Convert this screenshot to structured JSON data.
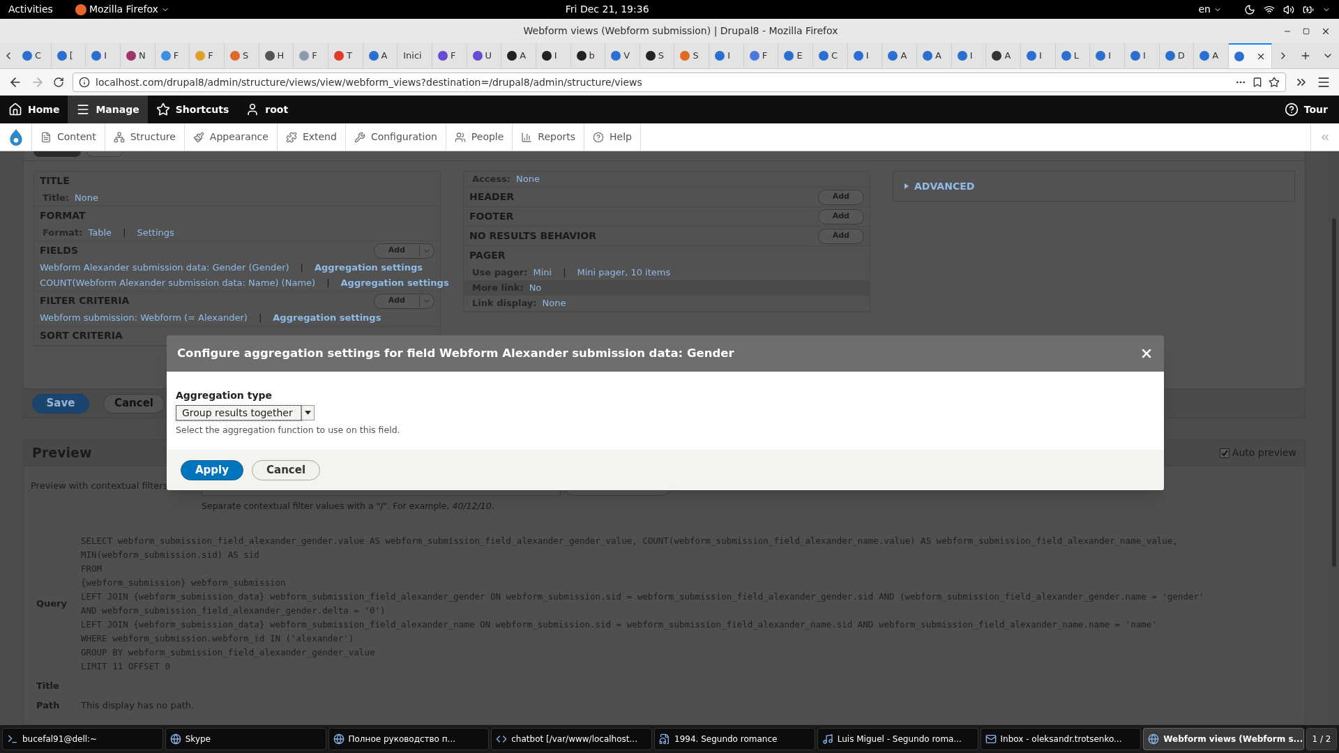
{
  "system_bar": {
    "activities": "Activities",
    "app_menu": "Mozilla Firefox",
    "clock": "Fri Dec 21, 19:36",
    "language": "en"
  },
  "window": {
    "title": "Webform views (Webform submission) | Drupal8 - Mozilla Firefox"
  },
  "browser_tabs": [
    {
      "label": "C",
      "color": "#2a6fd1",
      "selected": false
    },
    {
      "label": "[",
      "color": "#2a6fd1",
      "selected": false
    },
    {
      "label": "I",
      "color": "#2a6fd1",
      "selected": false
    },
    {
      "label": "N",
      "color": "#a0356b",
      "selected": false
    },
    {
      "label": "F",
      "color": "#3b8fe0",
      "selected": false
    },
    {
      "label": "F",
      "color": "#e0a030",
      "selected": false
    },
    {
      "label": "S",
      "color": "#e06a30",
      "selected": false
    },
    {
      "label": "H",
      "color": "#555555",
      "selected": false
    },
    {
      "label": "F",
      "color": "#8a9ab0",
      "selected": false
    },
    {
      "label": "T",
      "color": "#e03a2a",
      "selected": false
    },
    {
      "label": "A",
      "color": "#2a6fd1",
      "selected": false
    },
    {
      "label": "Inici",
      "selected": false
    },
    {
      "label": "F",
      "color": "#6a4ad0",
      "selected": false
    },
    {
      "label": "U",
      "color": "#6a4ad0",
      "selected": false
    },
    {
      "label": "A",
      "color": "#222222",
      "selected": false
    },
    {
      "label": "I",
      "color": "#222222",
      "selected": false
    },
    {
      "label": "b",
      "color": "#222222",
      "selected": false
    },
    {
      "label": "V",
      "color": "#2a6fd1",
      "selected": false
    },
    {
      "label": "S",
      "color": "#222222",
      "selected": false
    },
    {
      "label": "S",
      "color": "#e06a20",
      "selected": false
    },
    {
      "label": "I",
      "color": "#2a6fd1",
      "selected": false
    },
    {
      "label": "F",
      "color": "#4a7ae0",
      "selected": false
    },
    {
      "label": "E",
      "color": "#2a6fd1",
      "selected": false
    },
    {
      "label": "C",
      "color": "#2a6fd1",
      "selected": false
    },
    {
      "label": "I",
      "color": "#2a6fd1",
      "selected": false
    },
    {
      "label": "A",
      "color": "#2a6fd1",
      "selected": false
    },
    {
      "label": "A",
      "color": "#2a6fd1",
      "selected": false
    },
    {
      "label": "I",
      "color": "#2a6fd1",
      "selected": false
    },
    {
      "label": "A",
      "color": "#333333",
      "selected": false
    },
    {
      "label": "I",
      "color": "#2a6fd1",
      "selected": false
    },
    {
      "label": "L",
      "color": "#2a6fd1",
      "selected": false
    },
    {
      "label": "I",
      "color": "#2a6fd1",
      "selected": false
    },
    {
      "label": "I",
      "color": "#2a6fd1",
      "selected": false
    },
    {
      "label": "D",
      "color": "#2a6fd1",
      "selected": false
    },
    {
      "label": "A",
      "color": "#2a6fd1",
      "selected": false
    },
    {
      "color": "#2a6fd1",
      "selected": true
    }
  ],
  "address_bar": {
    "url": "localhost.com/drupal8/admin/structure/views/view/webform_views?destination=/drupal8/admin/structure/views"
  },
  "admin_toolbar": {
    "items": [
      {
        "label": "Home",
        "selected": false
      },
      {
        "label": "Manage",
        "selected": true
      },
      {
        "label": "Shortcuts",
        "selected": false
      },
      {
        "label": "root",
        "selected": false
      }
    ],
    "tour": "Tour"
  },
  "admin_tray": {
    "items": [
      "Content",
      "Structure",
      "Appearance",
      "Extend",
      "Configuration",
      "People",
      "Reports",
      "Help"
    ]
  },
  "left_column": [
    {
      "heading": "TITLE",
      "rows": [
        {
          "label": "Title:",
          "links": [
            "None"
          ]
        }
      ]
    },
    {
      "heading": "FORMAT",
      "rows": [
        {
          "label": "Format:",
          "links": [
            "Table",
            "Settings"
          ]
        }
      ]
    },
    {
      "heading": "FIELDS",
      "add": "Add",
      "rows": [
        {
          "links": [
            "Webform Alexander submission data: Gender (Gender)"
          ],
          "action": "Aggregation settings"
        },
        {
          "links": [
            "COUNT(Webform Alexander submission data: Name) (Name)"
          ],
          "action": "Aggregation settings"
        }
      ]
    },
    {
      "heading": "FILTER CRITERIA",
      "add": "Add",
      "rows": [
        {
          "links": [
            "Webform submission: Webform (= Alexander)"
          ],
          "action": "Aggregation settings"
        }
      ]
    },
    {
      "heading": "SORT CRITERIA"
    }
  ],
  "middle_column": [
    {
      "rows": [
        {
          "label": "Access:",
          "links": [
            "None"
          ]
        }
      ]
    },
    {
      "heading": "HEADER",
      "single": "Add"
    },
    {
      "heading": "FOOTER",
      "single": "Add"
    },
    {
      "heading": "NO RESULTS BEHAVIOR",
      "single": "Add"
    },
    {
      "heading": "PAGER",
      "rows": [
        {
          "label": "Use pager:",
          "links": [
            "Mini",
            "Mini pager, 10 items"
          ]
        },
        {
          "label": "More link:",
          "links": [
            "No"
          ]
        },
        {
          "label": "Link display:",
          "links": [
            "None"
          ]
        }
      ]
    }
  ],
  "link_separator": "|",
  "advanced": "ADVANCED",
  "form_actions": [
    "Save",
    "Cancel"
  ],
  "preview": {
    "title": "Preview",
    "auto_preview": {
      "label": "Auto preview",
      "checked": true
    },
    "contextual_label": "Preview with contextual filters",
    "help": "Separate contextual filter values with a \"/\". For example, *40/12/10*.",
    "query_label": "Query",
    "query_lines": [
      "SELECT webform_submission_field_alexander_gender.value AS webform_submission_field_alexander_gender_value, COUNT(webform_submission_field_alexander_name.value) AS webform_submission_field_alexander_name_value,",
      "MIN(webform_submission.sid) AS sid",
      "FROM",
      "{webform_submission} webform_submission",
      "LEFT JOIN {webform_submission_data} webform_submission_field_alexander_gender ON webform_submission.sid = webform_submission_field_alexander_gender.sid AND (webform_submission_field_alexander_gender.name = 'gender'",
      "AND webform_submission_field_alexander_gender.delta = '0')",
      "LEFT JOIN {webform_submission_data} webform_submission_field_alexander_name ON webform_submission.sid = webform_submission_field_alexander_name.sid AND webform_submission_field_alexander_name.name = 'name'",
      "WHERE webform_submission.webform_id IN ('alexander')",
      "GROUP BY webform_submission_field_alexander_gender_value",
      "LIMIT 11 OFFSET 0"
    ],
    "details": [
      {
        "label": "Title"
      },
      {
        "label": "Path",
        "value": "This display has no path."
      }
    ]
  },
  "dialog": {
    "title": "Configure aggregation settings for field Webform Alexander submission data: Gender",
    "field_label": "Aggregation type",
    "select_value": "Group results together",
    "description": "Select the aggregation function to use on this field.",
    "buttons": [
      "Apply",
      "Cancel"
    ]
  },
  "taskbar": {
    "items": [
      {
        "label": "bucefal91@dell:~",
        "selected": false
      },
      {
        "label": "Skype",
        "selected": false
      },
      {
        "label": "Полное руководство п...",
        "selected": false
      },
      {
        "label": "chatbot [/var/www/localhost...",
        "selected": false
      },
      {
        "label": "1994. Segundo romance",
        "selected": false
      },
      {
        "label": "Luis Miguel - Segundo roma...",
        "selected": false
      },
      {
        "label": "Inbox - oleksandr.trotsenko...",
        "selected": false
      },
      {
        "label": "Webform views (Webform s...",
        "selected": true
      }
    ],
    "pager": "1 / 2"
  }
}
